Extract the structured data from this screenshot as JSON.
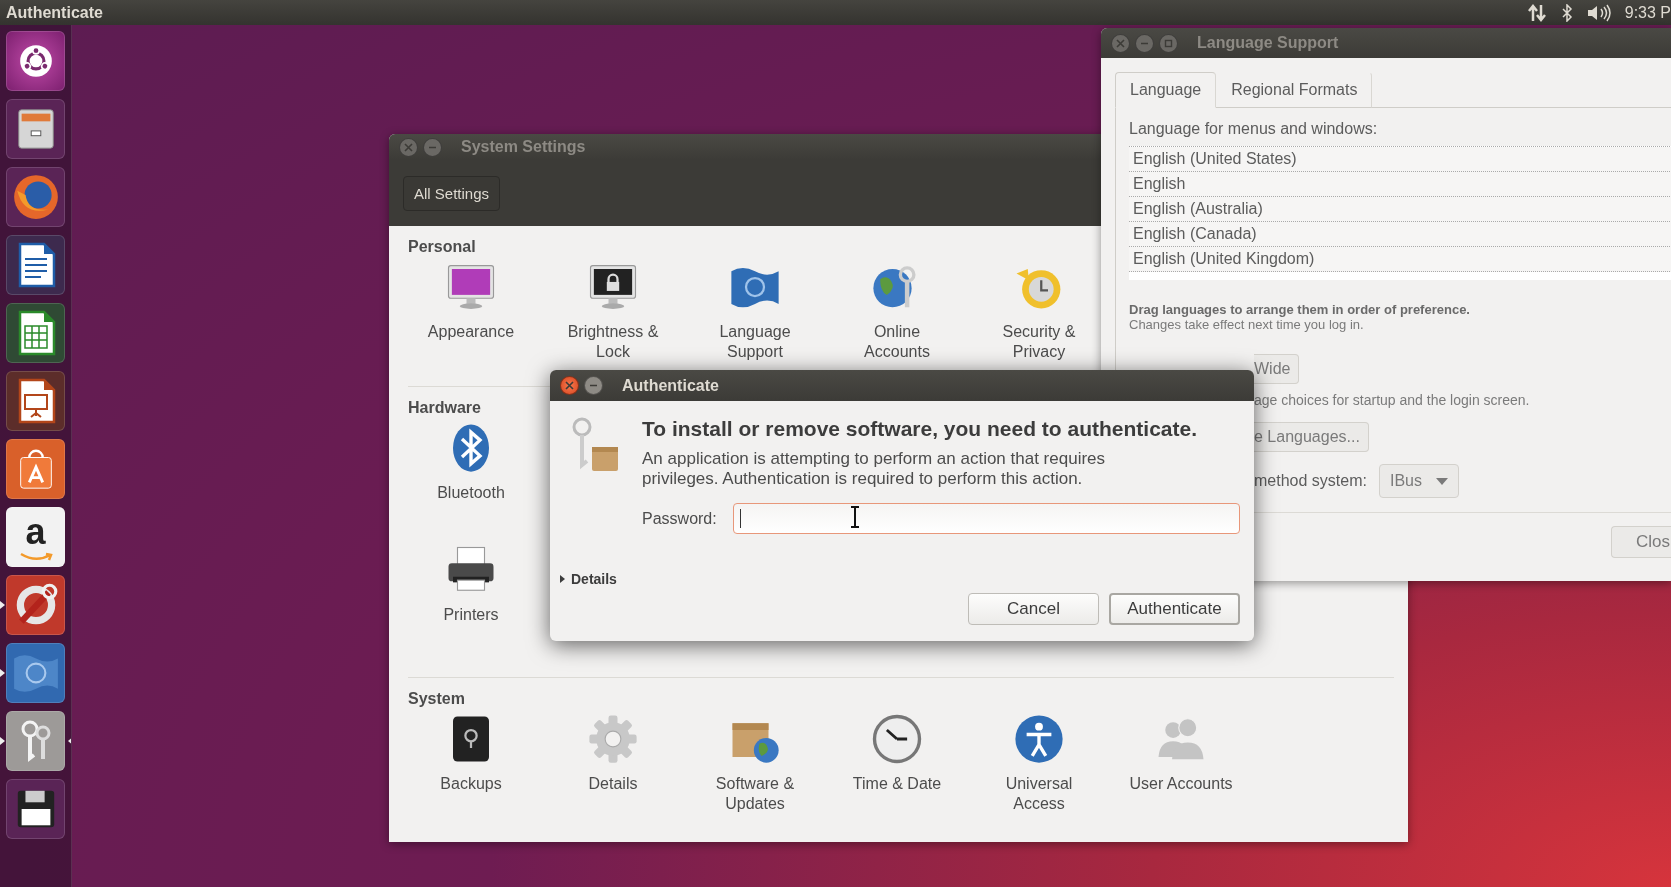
{
  "top_panel": {
    "title": "Authenticate",
    "clock": "9:33 P"
  },
  "launcher": [
    {
      "kind": "ubuntu",
      "running": false,
      "focused": false
    },
    {
      "kind": "files",
      "running": false,
      "focused": false
    },
    {
      "kind": "firefox",
      "running": false,
      "focused": false
    },
    {
      "kind": "writer",
      "running": false,
      "focused": false
    },
    {
      "kind": "calc",
      "running": false,
      "focused": false
    },
    {
      "kind": "impress",
      "running": false,
      "focused": false
    },
    {
      "kind": "software",
      "running": false,
      "focused": false
    },
    {
      "kind": "amazon",
      "glyph": "a",
      "running": false,
      "focused": false
    },
    {
      "kind": "tools",
      "running": true,
      "focused": false
    },
    {
      "kind": "language",
      "running": true,
      "focused": false
    },
    {
      "kind": "keys",
      "running": true,
      "focused": true
    },
    {
      "kind": "floppy",
      "running": false,
      "focused": false
    }
  ],
  "system_settings": {
    "title": "System Settings",
    "active": false,
    "controls": [
      {
        "kind": "close"
      },
      {
        "kind": "minimize"
      }
    ],
    "toolbar_button": "All Settings",
    "sections": [
      {
        "title": "Personal",
        "rows": [
          [
            {
              "kind": "appearance",
              "label": "Appearance"
            },
            {
              "kind": "brightness",
              "label": "Brightness & Lock"
            },
            {
              "kind": "language",
              "label": "Language Support"
            },
            {
              "kind": "online",
              "label": "Online Accounts"
            },
            {
              "kind": "security",
              "label": "Security & Privacy"
            }
          ]
        ]
      },
      {
        "title": "Hardware",
        "rows": [
          [
            {
              "kind": "bluetooth",
              "label": "Bluetooth"
            }
          ],
          [
            {
              "kind": "printer",
              "label": "Printers"
            }
          ]
        ]
      },
      {
        "title": "System",
        "rows": [
          [
            {
              "kind": "backups",
              "label": "Backups"
            },
            {
              "kind": "details",
              "label": "Details"
            },
            {
              "kind": "software",
              "label": "Software & Updates"
            },
            {
              "kind": "time",
              "label": "Time & Date"
            },
            {
              "kind": "access",
              "label": "Universal Access"
            },
            {
              "kind": "users",
              "label": "User Accounts"
            }
          ]
        ]
      }
    ]
  },
  "language_support": {
    "title": "Language Support",
    "active": false,
    "controls": [
      {
        "kind": "close"
      },
      {
        "kind": "minimize"
      },
      {
        "kind": "maximize"
      }
    ],
    "tabs": [
      {
        "label": "Language",
        "selected": true
      },
      {
        "label": "Regional Formats",
        "selected": false
      }
    ],
    "list_label": "Language for menus and windows:",
    "languages": [
      "English (United States)",
      "English",
      "English (Australia)",
      "English (Canada)",
      "English (United Kingdom)"
    ],
    "hint_bold": "Drag languages to arrange them in order of preference.",
    "hint": "Changes take effect next time you log in.",
    "apply_button": "Wide",
    "apply_note": "age choices for startup and the login screen.",
    "install_button": "e Languages...",
    "input_label": "method system:",
    "input_method": "IBus",
    "close_button": "Clos"
  },
  "dialog": {
    "title": "Authenticate",
    "active": true,
    "controls": [
      {
        "kind": "close"
      },
      {
        "kind": "minimize"
      }
    ],
    "heading": "To install or remove software, you need to authenticate.",
    "message": "An application is attempting to perform an action that requires privileges. Authentication is required to perform this action.",
    "password_label": "Password:",
    "password_focused": true,
    "details": {
      "label": "Details",
      "expanded": false
    },
    "buttons": [
      {
        "label": "Cancel",
        "default": false
      },
      {
        "label": "Authenticate",
        "default": true
      }
    ]
  }
}
